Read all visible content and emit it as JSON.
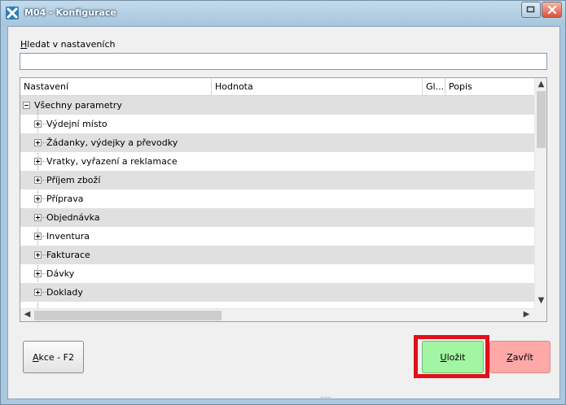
{
  "window": {
    "title": "M04 - Konfigurace"
  },
  "search": {
    "label_accel": "H",
    "label_rest": "ledat v nastaveních",
    "value": "",
    "placeholder": ""
  },
  "grid": {
    "columns": [
      "Nastavení",
      "Hodnota",
      "Gl...",
      "Popis"
    ],
    "root": {
      "label": "Všechny parametry",
      "expanded": true
    },
    "items": [
      {
        "label": "Výdejní místo"
      },
      {
        "label": "Žádanky, výdejky a převodky"
      },
      {
        "label": "Vratky, vyřazení a reklamace"
      },
      {
        "label": "Příjem zboží"
      },
      {
        "label": "Příprava"
      },
      {
        "label": "Objednávka"
      },
      {
        "label": "Inventura"
      },
      {
        "label": "Fakturace"
      },
      {
        "label": "Dávky"
      },
      {
        "label": "Doklady"
      }
    ]
  },
  "buttons": {
    "akce_accel": "A",
    "akce_rest": "kce - F2",
    "ulozit_accel": "U",
    "ulozit_rest": "ložit",
    "zavrit_accel": "Z",
    "zavrit_rest": "avřít"
  },
  "colors": {
    "save_button": "#a2f5a2",
    "close_button": "#ffa8a8",
    "highlight_border": "#e0101a",
    "alt_row": "#e0e0e0"
  }
}
